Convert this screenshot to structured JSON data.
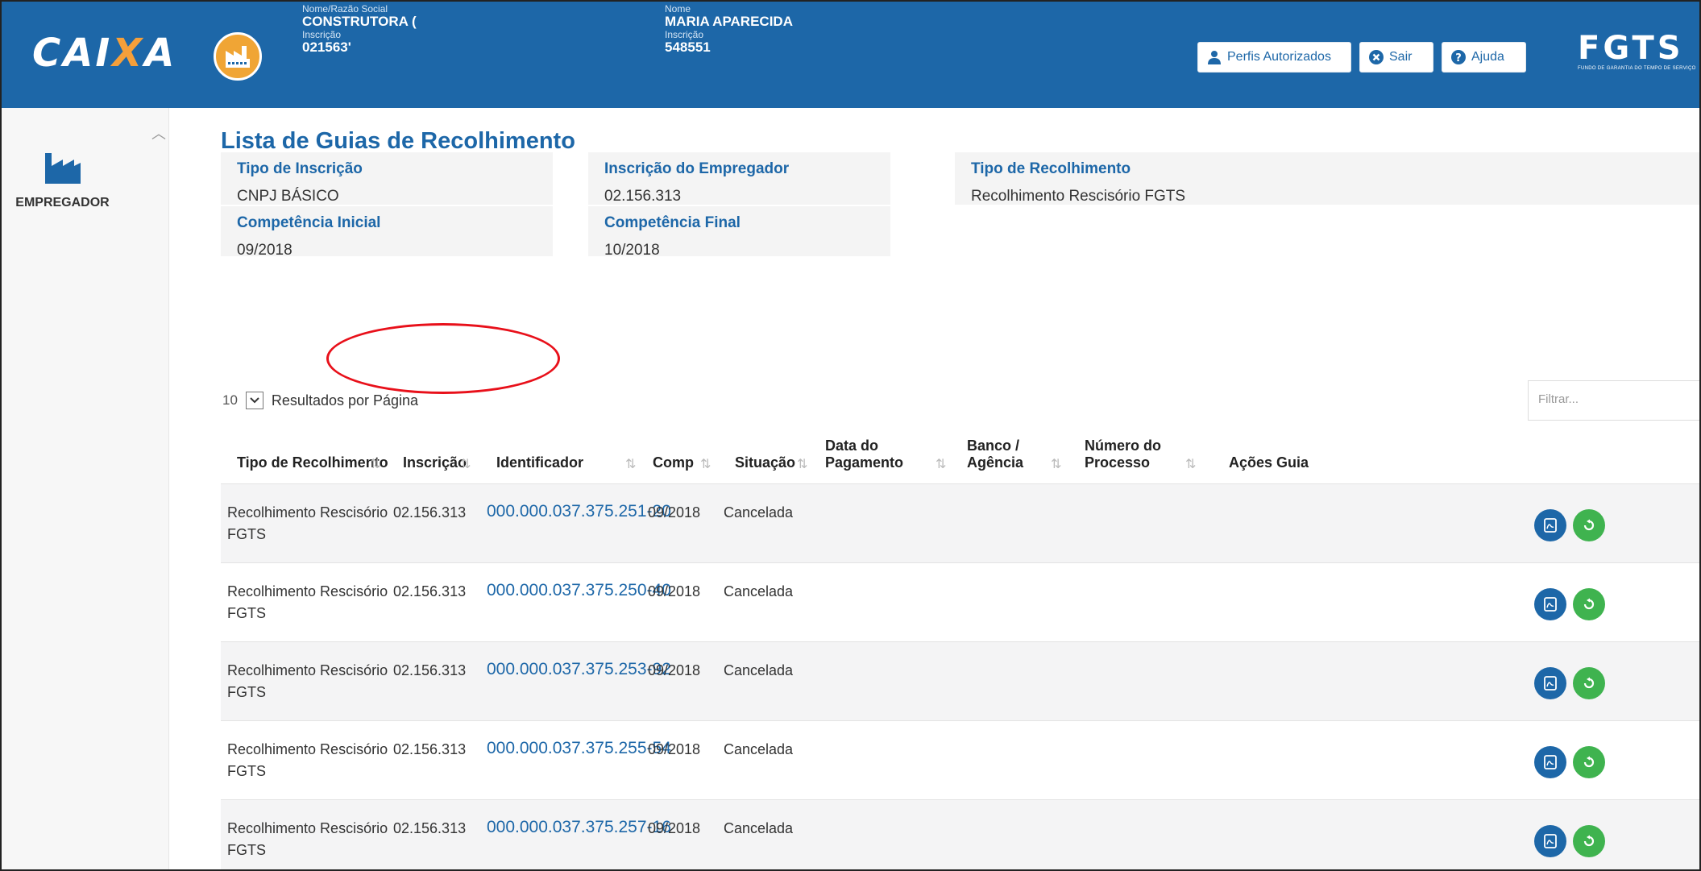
{
  "header": {
    "brand_left": "CAIXA",
    "company": {
      "name_label": "Nome/Razão Social",
      "name": "CONSTRUTORA (",
      "insc_label": "Inscrição",
      "insc": "021563'"
    },
    "person": {
      "name_label": "Nome",
      "name": "MARIA APARECIDA",
      "insc_label": "Inscrição",
      "insc": "548551"
    },
    "buttons": {
      "perfis": "Perfis Autorizados",
      "sair": "Sair",
      "ajuda": "Ajuda"
    },
    "brand_right": "FGTS",
    "brand_right_sub": "FUNDO DE GARANTIA DO TEMPO DE SERVIÇO"
  },
  "sidebar": {
    "section_label": "EMPREGADOR"
  },
  "page": {
    "title": "Lista de Guias de Recolhimento",
    "info": {
      "tipo_inscricao": {
        "label": "Tipo de Inscrição",
        "value": "CNPJ BÁSICO"
      },
      "inscricao_empregador": {
        "label": "Inscrição do Empregador",
        "value": "02.156.313"
      },
      "tipo_recolhimento": {
        "label": "Tipo de Recolhimento",
        "value": "Recolhimento Rescisório FGTS"
      },
      "competencia_inicial": {
        "label": "Competência Inicial",
        "value": "09/2018"
      },
      "competencia_final": {
        "label": "Competência Final",
        "value": "10/2018"
      }
    },
    "per_page": {
      "value": "10",
      "label": "Resultados por Página"
    },
    "filter_placeholder": "Filtrar..."
  },
  "table": {
    "columns": {
      "tipo": "Tipo de Recolhimento",
      "inscricao": "Inscrição",
      "identificador": "Identificador",
      "comp": "Comp",
      "situacao": "Situação",
      "data_pagamento_1": "Data do",
      "data_pagamento_2": "Pagamento",
      "banco_1": "Banco /",
      "banco_2": "Agência",
      "processo_1": "Número do",
      "processo_2": "Processo",
      "acoes": "Ações Guia"
    },
    "rows": [
      {
        "tipo_1": "Recolhimento Rescisório",
        "tipo_2": "FGTS",
        "inscricao": "02.156.313",
        "identificador": "000.000.037.375.251-20",
        "comp": "09/2018",
        "situacao": "Cancelada"
      },
      {
        "tipo_1": "Recolhimento Rescisório",
        "tipo_2": "FGTS",
        "inscricao": "02.156.313",
        "identificador": "000.000.037.375.250-40",
        "comp": "09/2018",
        "situacao": "Cancelada"
      },
      {
        "tipo_1": "Recolhimento Rescisório",
        "tipo_2": "FGTS",
        "inscricao": "02.156.313",
        "identificador": "000.000.037.375.253-92",
        "comp": "09/2018",
        "situacao": "Cancelada"
      },
      {
        "tipo_1": "Recolhimento Rescisório",
        "tipo_2": "FGTS",
        "inscricao": "02.156.313",
        "identificador": "000.000.037.375.255-54",
        "comp": "09/2018",
        "situacao": "Cancelada"
      },
      {
        "tipo_1": "Recolhimento Rescisório",
        "tipo_2": "FGTS",
        "inscricao": "02.156.313",
        "identificador": "000.000.037.375.257-16",
        "comp": "09/2018",
        "situacao": "Cancelada"
      }
    ]
  },
  "colors": {
    "primary": "#1d67a8",
    "success": "#3fb34f",
    "accent": "#f59f3a",
    "annotation": "#e8101a"
  },
  "icons": [
    "user-icon",
    "close-circle-icon",
    "help-circle-icon",
    "factory-icon",
    "sort-icon",
    "pdf-icon",
    "redo-icon",
    "chevron-down-icon",
    "chevron-up-icon"
  ]
}
